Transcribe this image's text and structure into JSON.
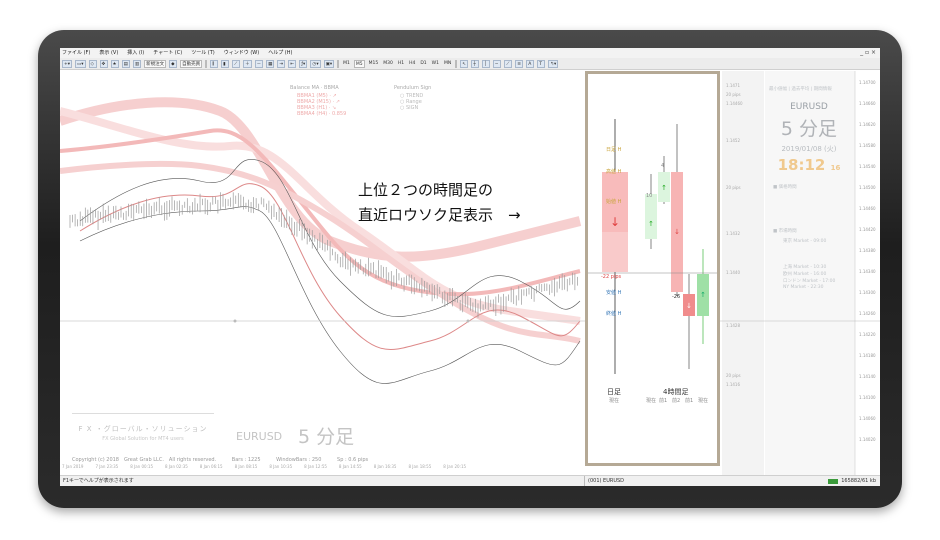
{
  "menu": [
    "ファイル (F)",
    "表示 (V)",
    "挿入 (I)",
    "チャート (C)",
    "ツール (T)",
    "ウィンドウ (W)",
    "ヘルプ (H)"
  ],
  "toolbar": {
    "new_order": "新規注文",
    "auto_trade": "自動売買",
    "timeframes": [
      "M1",
      "M5",
      "M15",
      "M30",
      "H1",
      "H4",
      "D1",
      "W1",
      "MN"
    ]
  },
  "indicator_legend": {
    "balance_title": "Balance MA · BBMA",
    "pendulum_title": "Pendulum Sign",
    "balance_rows": [
      "BBMA1 (M5) · ↗",
      "BBMA2 (M15) · ↗",
      "BBMA3 (H1) · ↘",
      "BBMA4 (H4) · 0.859"
    ],
    "pendulum_rows": [
      "○ TREND",
      "○ Range",
      "○ SIGN"
    ]
  },
  "annotation": {
    "line1": "上位２つの時間足の",
    "line2": "直近ロウソク足表示　→"
  },
  "candle_panel": {
    "labels_left": [
      "日足 H",
      "高値 H",
      "始値 H",
      "-22 pips",
      "安値 H",
      "終値 H"
    ],
    "pip_labels": [
      "10",
      "-26",
      "4"
    ],
    "bottom_left": "日足",
    "bottom_left_sub": "現在",
    "bottom_right": "4時間足",
    "bottom_right_sub": [
      "現在",
      "前1",
      "前2",
      "前1",
      "現在"
    ],
    "colors": {
      "bull": "#9fe0a6",
      "bear": "#f08c8c",
      "bear_light": "#f9caca",
      "bull_light": "#dcf5de",
      "line": "#333333"
    }
  },
  "info_panel": {
    "header": "最小値幅 | 過去平均 | 期間情報",
    "symbol": "EURUSD",
    "timeframe": "5 分足",
    "date": "2019/01/08 (火)",
    "time": "18:12",
    "time_sec": "16",
    "sessions_title": "■ 価格時間",
    "market_title": "■ 市場時間",
    "market_rows": [
      "東京 Market - 09:00",
      "上海 Market - 10:30",
      "欧州 Market - 16:00",
      "ロンドン Market - 17:00",
      "NY Market - 22:30"
    ]
  },
  "price_scale_left": [
    "1.1471",
    "20 pips",
    "1.14460",
    "1.1452",
    "20 pips",
    "1.1432",
    "1.1440",
    "1.1428",
    "20 pips",
    "1.1416"
  ],
  "right_scale": [
    "1.14700",
    "1.14660",
    "1.14620",
    "1.14580",
    "1.14540",
    "1.14500",
    "1.14460",
    "1.14420",
    "1.14380",
    "1.14340",
    "1.14300",
    "1.14260",
    "1.14220",
    "1.14180",
    "1.14140",
    "1.14100",
    "1.14060",
    "1.14020"
  ],
  "branding": {
    "jp": "F X ・グローバル・ソリューション",
    "en": "FX Global Solution for MT4 users",
    "watermark_symbol": "EURUSD",
    "watermark_tf": "5 分足"
  },
  "copyright": [
    "Copyright (c) 2018　Great Grab LLC.　All rights reserved.",
    "Bars : 1225",
    "WindowBars : 250",
    "Sp : 0.6 pips"
  ],
  "time_axis": [
    "7 Jan 2019",
    "7 Jan 23:35",
    "8 Jan 00:15",
    "8 Jan 02:35",
    "8 Jan 06:15",
    "8 Jan 08:15",
    "8 Jan 10:35",
    "8 Jan 12:55",
    "8 Jan 14:55",
    "8 Jan 16:35",
    "8 Jan 18:55",
    "8 Jan 20:15"
  ],
  "status": {
    "help": "F1キーでヘルプが表示されます",
    "code": "(001) EURUSD",
    "transfer": "165882/61 kb"
  }
}
